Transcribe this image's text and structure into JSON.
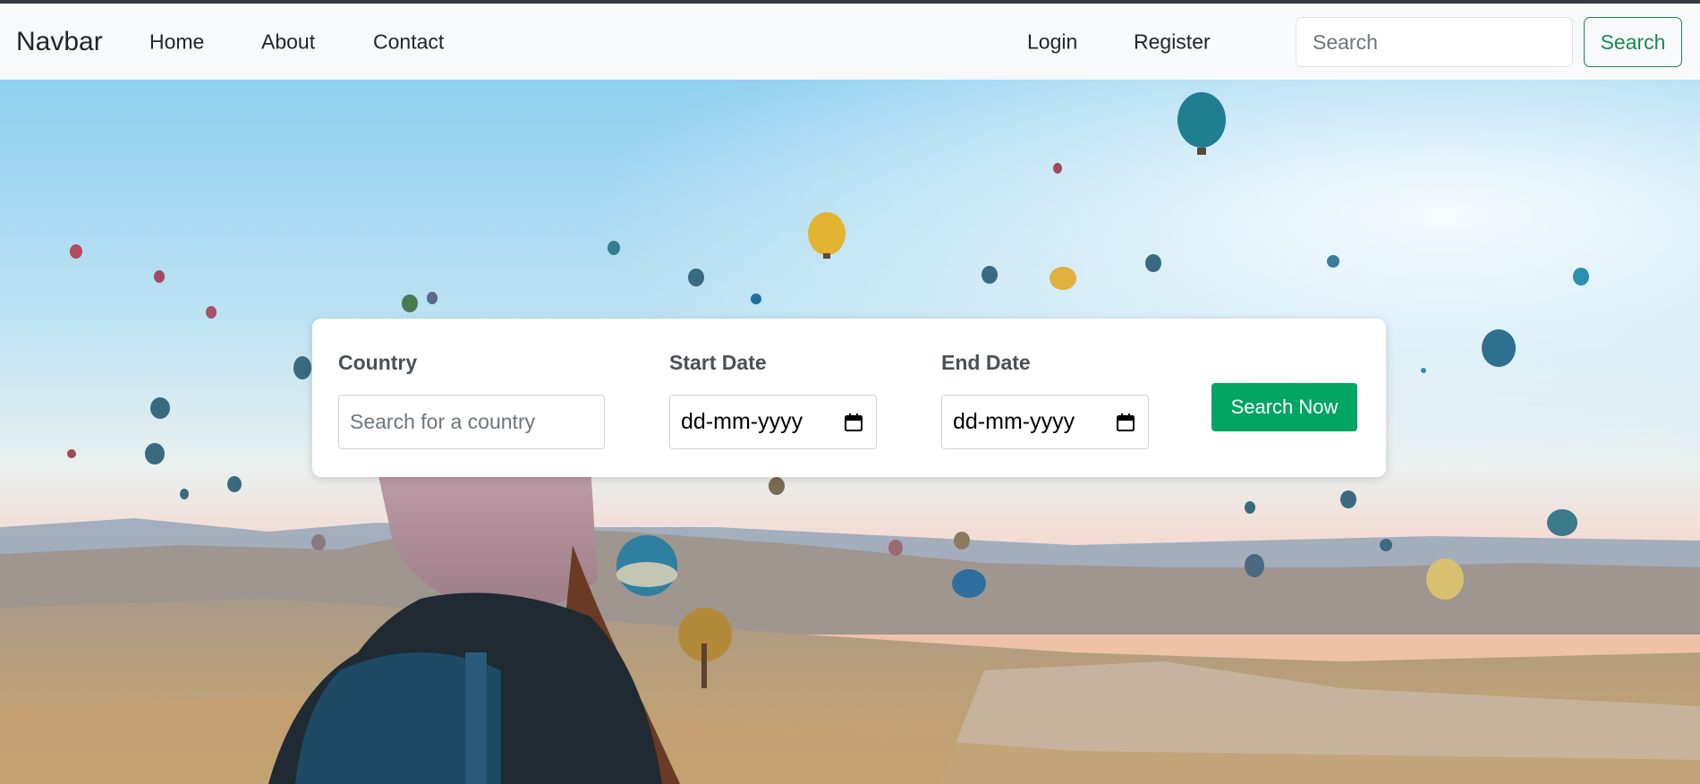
{
  "navbar": {
    "brand": "Navbar",
    "links": {
      "home": "Home",
      "about": "About",
      "contact": "Contact",
      "login": "Login",
      "register": "Register"
    },
    "search": {
      "placeholder": "Search",
      "value": "",
      "button_label": "Search"
    }
  },
  "search_card": {
    "country": {
      "label": "Country",
      "placeholder": "Search for a country",
      "value": ""
    },
    "start_date": {
      "label": "Start Date",
      "display": "dd-mm-yyyy",
      "icon": "calendar-icon"
    },
    "end_date": {
      "label": "End Date",
      "display": "dd-mm-yyyy",
      "icon": "calendar-icon"
    },
    "submit_label": "Search Now"
  },
  "colors": {
    "navbar_bg": "#f8f9fa",
    "top_strip": "#343a40",
    "outline_green": "#198754",
    "submit_green": "#00a563",
    "label_text": "#495057"
  }
}
